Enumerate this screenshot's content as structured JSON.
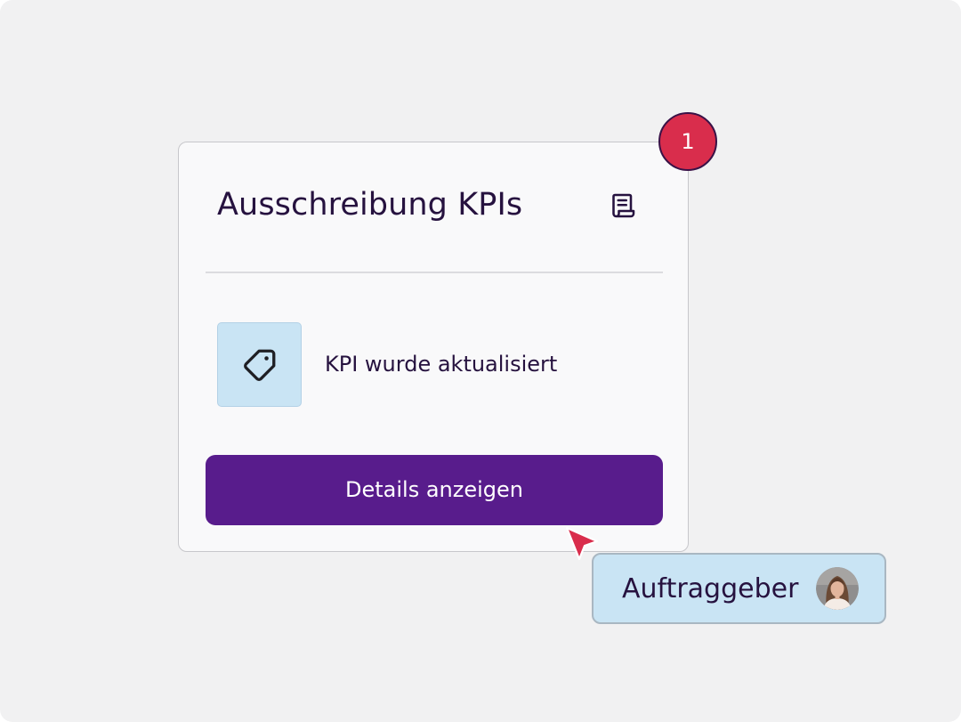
{
  "notification": {
    "title": "Ausschreibung KPIs",
    "title_icon": "document-icon",
    "badge_count": "1",
    "event_icon": "tag-icon",
    "event_text": "KPI wurde aktualisiert",
    "action_label": "Details anzeigen"
  },
  "user_tag": {
    "role_label": "Auftraggeber",
    "avatar_icon": "avatar"
  },
  "colors": {
    "primary": "#581c8c",
    "badge": "#d92d4c",
    "text": "#26123f",
    "highlight": "#c9e4f4",
    "background": "#f1f1f2"
  }
}
